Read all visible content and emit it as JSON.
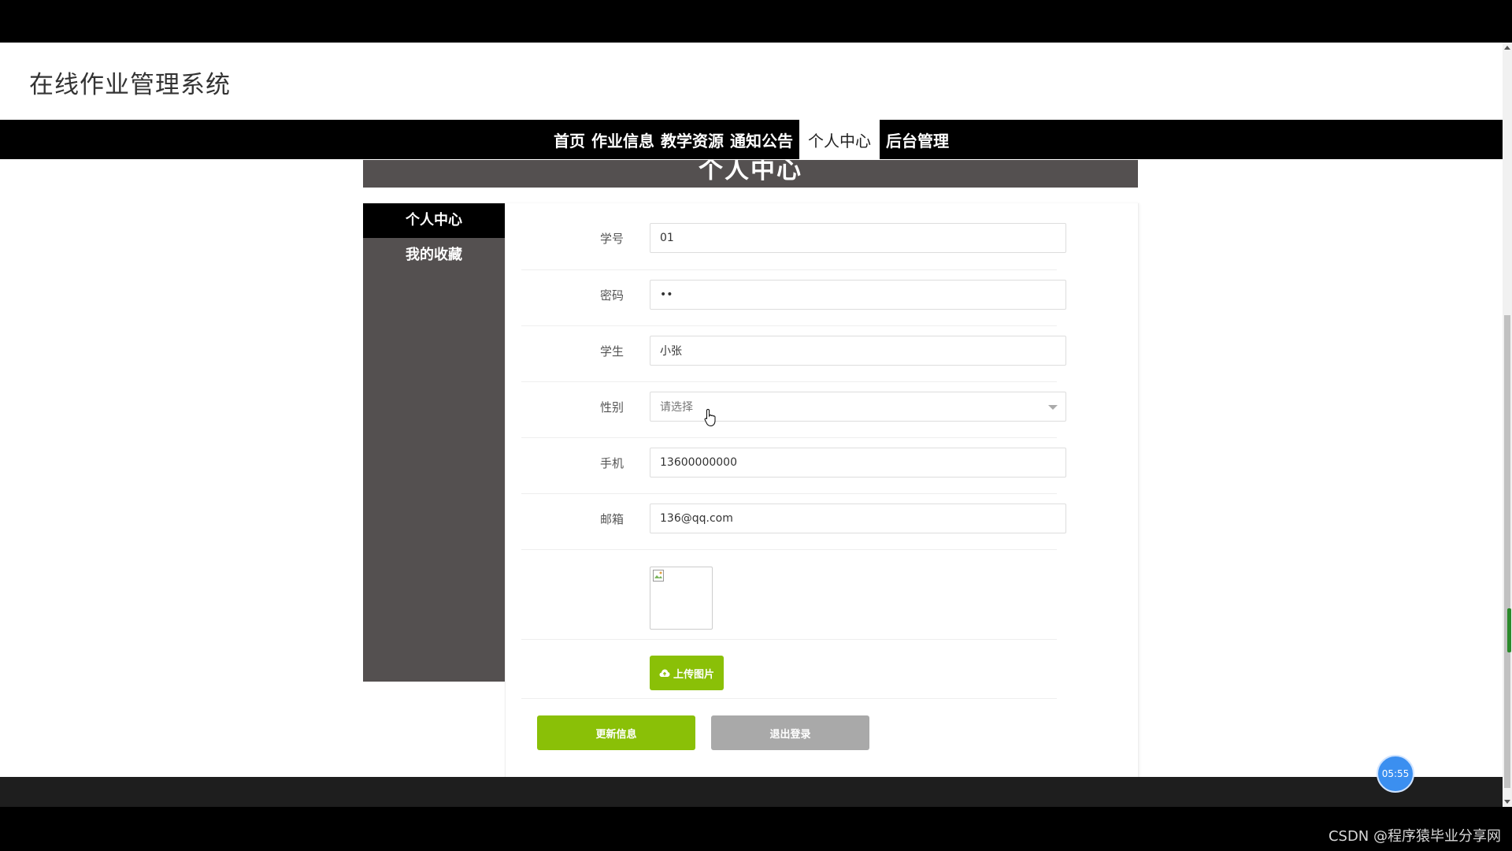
{
  "site": {
    "title": "在线作业管理系统"
  },
  "nav": {
    "items": [
      {
        "label": "首页"
      },
      {
        "label": "作业信息"
      },
      {
        "label": "教学资源"
      },
      {
        "label": "通知公告"
      },
      {
        "label": "个人中心"
      },
      {
        "label": "后台管理"
      }
    ],
    "active": "个人中心"
  },
  "page": {
    "header": "个人中心"
  },
  "sidebar": {
    "items": [
      {
        "label": "个人中心"
      },
      {
        "label": "我的收藏"
      }
    ]
  },
  "form": {
    "student_id": {
      "label": "学号",
      "value": "01"
    },
    "password": {
      "label": "密码",
      "value": "••"
    },
    "student_name": {
      "label": "学生",
      "value": "小张"
    },
    "gender": {
      "label": "性别",
      "placeholder": "请选择"
    },
    "phone": {
      "label": "手机",
      "value": "13600000000"
    },
    "email": {
      "label": "邮箱",
      "value": "136@qq.com"
    },
    "upload_label": "上传图片",
    "update_label": "更新信息",
    "logout_label": "退出登录"
  },
  "overlay": {
    "timer": "05:55",
    "watermark": "CSDN @程序猿毕业分享网"
  },
  "colors": {
    "accent_green": "#8ac007",
    "sidebar_bg": "#545050",
    "nav_bg": "#000000",
    "logout_gray": "#a9a9a9"
  }
}
